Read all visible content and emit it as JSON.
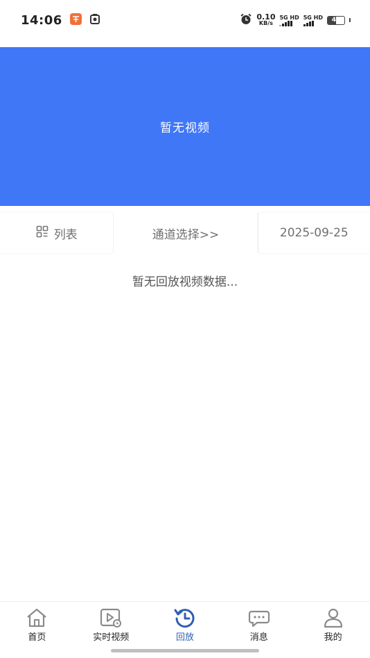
{
  "status_bar": {
    "time": "14:06",
    "speed_value": "0.10",
    "speed_unit": "KB/s",
    "sim1_label": "5G HD",
    "sim2_label": "5G HD",
    "battery_level": 49,
    "battery_text": "49"
  },
  "video": {
    "message": "暂无视频",
    "background_color": "#4077f6"
  },
  "filter_bar": {
    "list_label": "列表",
    "channel_label": "通道选择>>",
    "date_label": "2025-09-25"
  },
  "content": {
    "empty_message": "暂无回放视频数据..."
  },
  "bottom_nav": {
    "items": [
      {
        "label": "首页",
        "icon": "home-icon",
        "active": false
      },
      {
        "label": "实时视频",
        "icon": "live-video-icon",
        "active": false
      },
      {
        "label": "回放",
        "icon": "playback-icon",
        "active": true
      },
      {
        "label": "消息",
        "icon": "message-icon",
        "active": false
      },
      {
        "label": "我的",
        "icon": "profile-icon",
        "active": false
      }
    ],
    "active_color": "#2f5fb0",
    "inactive_color": "#8a8a8a"
  }
}
